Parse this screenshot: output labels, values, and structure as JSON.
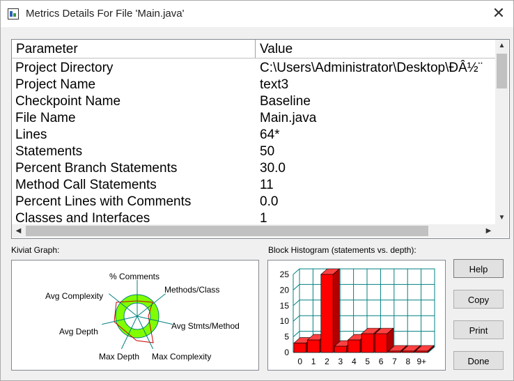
{
  "window": {
    "title": "Metrics Details For File 'Main.java'"
  },
  "table": {
    "headers": [
      "Parameter",
      "Value"
    ],
    "rows": [
      [
        "Project Directory",
        "C:\\Users\\Administrator\\Desktop\\ĐÂ½¨"
      ],
      [
        "Project Name",
        "text3"
      ],
      [
        "Checkpoint Name",
        "Baseline"
      ],
      [
        "File Name",
        "Main.java"
      ],
      [
        "Lines",
        "64*"
      ],
      [
        "Statements",
        "50"
      ],
      [
        "Percent Branch Statements",
        "30.0"
      ],
      [
        "Method Call Statements",
        "11"
      ],
      [
        "Percent Lines with Comments",
        "0.0"
      ],
      [
        "Classes and Interfaces",
        "1"
      ]
    ]
  },
  "kiviat": {
    "label": "Kiviat Graph:",
    "axes": [
      "% Comments",
      "Methods/Class",
      "Avg Stmts/Method",
      "Max Complexity",
      "Max Depth",
      "Avg Depth",
      "Avg Complexity"
    ]
  },
  "histogram": {
    "label": "Block Histogram (statements vs. depth):"
  },
  "chart_data": {
    "type": "bar",
    "title": "Block Histogram (statements vs. depth):",
    "categories": [
      "0",
      "1",
      "2",
      "3",
      "4",
      "5",
      "6",
      "7",
      "8",
      "9+"
    ],
    "values": [
      3,
      4,
      25,
      2,
      4,
      6,
      6,
      0,
      0,
      0
    ],
    "ylim": [
      0,
      25
    ],
    "yticks": [
      0,
      5,
      10,
      15,
      20,
      25
    ],
    "bar_color": "#ff0000",
    "grid_color": "#008080"
  },
  "buttons": {
    "help": "Help",
    "copy": "Copy",
    "print": "Print",
    "done": "Done"
  },
  "icons": {
    "close": "close-icon",
    "app": "metrics-app-icon"
  }
}
